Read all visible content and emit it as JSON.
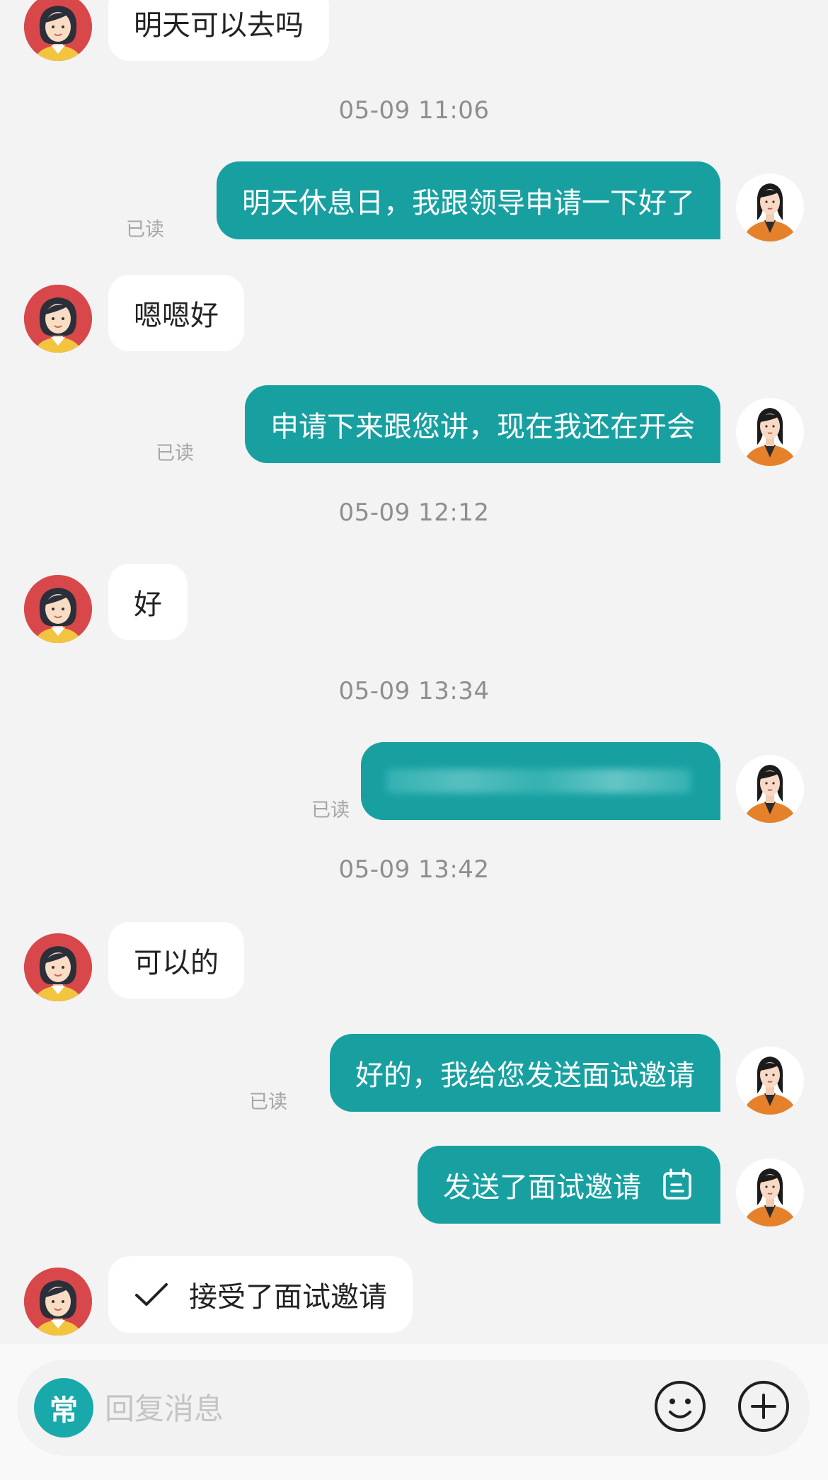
{
  "messages": [
    {
      "side": "in",
      "text": "明天可以去吗"
    },
    {
      "time": "05-09 11:06"
    },
    {
      "side": "out",
      "text": "明天休息日，我跟领导申请一下好了",
      "read": "已读"
    },
    {
      "side": "in",
      "text": "嗯嗯好"
    },
    {
      "side": "out",
      "text": "申请下来跟您讲，现在我还在开会",
      "read": "已读"
    },
    {
      "time": "05-09 12:12"
    },
    {
      "side": "in",
      "text": "好"
    },
    {
      "time": "05-09 13:34"
    },
    {
      "side": "out",
      "text": "",
      "blurred": true,
      "read": "已读"
    },
    {
      "time": "05-09 13:42"
    },
    {
      "side": "in",
      "text": "可以的"
    },
    {
      "side": "out",
      "text": "好的，我给您发送面试邀请",
      "read": "已读"
    },
    {
      "side": "out",
      "text": "发送了面试邀请",
      "icon": "calendar-icon"
    },
    {
      "side": "in",
      "text": "接受了面试邀请",
      "icon": "check-icon"
    }
  ],
  "composer": {
    "quick_badge": "常",
    "placeholder": "回复消息",
    "emoji_icon": "emoji-icon",
    "plus_icon": "plus-icon"
  },
  "colors": {
    "outgoing_bubble": "#18a0a1",
    "incoming_bubble": "#ffffff",
    "background": "#f3f3f3",
    "badge": "#19a9ab"
  }
}
